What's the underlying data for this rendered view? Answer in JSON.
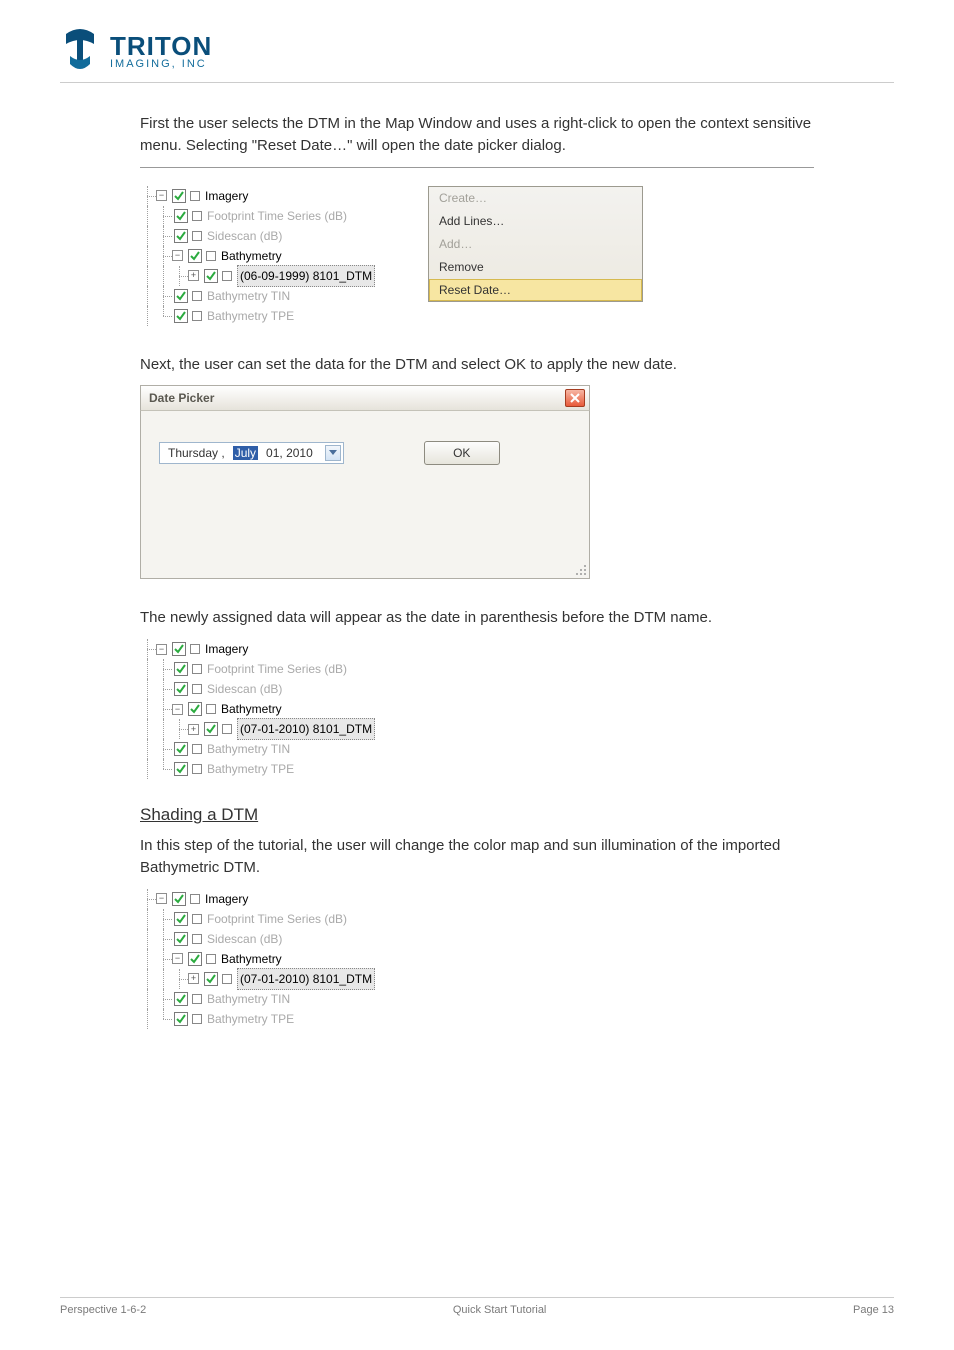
{
  "logo": {
    "name": "TRITON",
    "sub": "IMAGING, INC"
  },
  "p1": "First the user selects the DTM in the Map Window and uses a right-click to open the context sensitive menu.  Selecting \"Reset Date…\" will open the date picker dialog.",
  "p2": "Next, the user can set the data for the DTM and select OK to apply the new date.",
  "p3": "The newly assigned data will appear as the date in parenthesis before the DTM name.",
  "section": "Shading a DTM",
  "p4": "In this step of the tutorial, the user will change the color map and sun illumination of the imported Bathymetric DTM.",
  "tree1": {
    "imagery": "Imagery",
    "fts": "Footprint Time Series (dB)",
    "ss": "Sidescan (dB)",
    "bathy": "Bathymetry",
    "dtm": "(06-09-1999) 8101_DTM",
    "tin": "Bathymetry TIN",
    "tpe": "Bathymetry TPE"
  },
  "menu": {
    "create": "Create…",
    "addlines": "Add Lines…",
    "add": "Add…",
    "remove": "Remove",
    "reset": "Reset Date…"
  },
  "dlg": {
    "title": "Date Picker",
    "day": "Thursday ,",
    "month": "July",
    "dom": "01, 2010",
    "ok": "OK"
  },
  "tree2": {
    "imagery": "Imagery",
    "fts": "Footprint Time Series (dB)",
    "ss": "Sidescan (dB)",
    "bathy": "Bathymetry",
    "dtm": "(07-01-2010) 8101_DTM",
    "tin": "Bathymetry TIN",
    "tpe": "Bathymetry TPE"
  },
  "tree3": {
    "imagery": "Imagery",
    "fts": "Footprint Time Series (dB)",
    "ss": "Sidescan (dB)",
    "bathy": "Bathymetry",
    "dtm": "(07-01-2010) 8101_DTM",
    "tin": "Bathymetry TIN",
    "tpe": "Bathymetry TPE"
  },
  "footer": {
    "left": "Perspective 1-6-2",
    "center": "Quick Start Tutorial",
    "right": "Page 13"
  }
}
